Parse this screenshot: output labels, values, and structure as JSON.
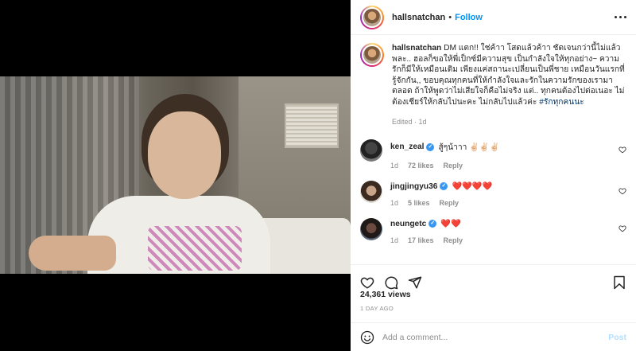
{
  "post": {
    "username": "hallsnatchan",
    "follow_label": "Follow",
    "dot": "•"
  },
  "caption": {
    "username": "hallsnatchan",
    "text": "DM แตก!! ใช่ค้าา โสดแล้วค้าา ชัดเจนกว่านี้ไม่แล้วพละ.. ฮอลก็ขอให้พี่เป็กซ์มีความสุข เป็นกำลังใจให้ทุกอย่าง~ ความรักก็มีให้เหมือนเดิม เพียงแค่สถานะเปลี่ยนเป็นพี่ชาย เหมือนวันแรกที่รู้จักกัน,, ขอบคุณทุกคนที่ให้กำลังใจและรักในความรักของเรามาตลอด ถ้าให้พูดว่าไม่เสียใจก็คือไม่จริง แต่.. ทุกคนต้องไปต่อเนอะ ไม่ต้องเชียร์ให้กลับไปนะคะ ไม่กลับไปแล้วค่ะ",
    "hashtag": "#รักทุกคนนะ",
    "meta": "Edited · 1d"
  },
  "comments": [
    {
      "username": "ken_zeal",
      "verified": true,
      "text": "สู้ๆน้าาา ✌🏻✌🏻✌🏻",
      "hearts": false,
      "age": "1d",
      "likes": "72 likes",
      "reply": "Reply"
    },
    {
      "username": "jingjingyu36",
      "verified": true,
      "text": "❤️❤️❤️❤️",
      "hearts": true,
      "age": "1d",
      "likes": "5 likes",
      "reply": "Reply"
    },
    {
      "username": "neungetc",
      "verified": true,
      "text": "❤️❤️",
      "hearts": true,
      "age": "1d",
      "likes": "17 likes",
      "reply": "Reply"
    }
  ],
  "stats": {
    "views": "24,361 views",
    "age": "1 DAY AGO"
  },
  "add_comment": {
    "placeholder": "Add a comment...",
    "post_label": "Post"
  },
  "icons": {
    "more": "more-icon",
    "like": "heart-icon",
    "comment": "comment-icon",
    "share": "send-icon",
    "save": "bookmark-icon",
    "emoji": "emoji-icon",
    "verified": "verified-badge-icon"
  },
  "colors": {
    "link": "#0095f6",
    "hashtag": "#00376b",
    "muted": "#8e8e8e",
    "verified": "#3897f0",
    "heart": "#ed4956"
  }
}
